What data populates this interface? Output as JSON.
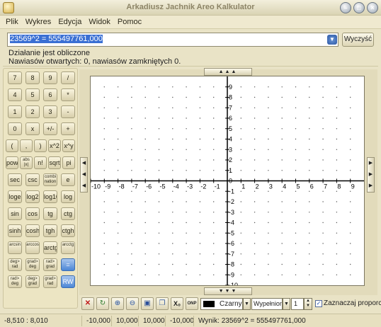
{
  "window": {
    "title": "Arkadiusz Jachnik Areo Kalkulator"
  },
  "menu": [
    "Plik",
    "Wykres",
    "Edycja",
    "Widok",
    "Pomoc"
  ],
  "expression": {
    "value": "23569^2 = 555497761,000",
    "clear_label": "Wyczyść"
  },
  "status": {
    "line1": "Działanie jest obliczone",
    "line2": "Nawiasów otwartych: 0, nawiasów zamkniętych 0."
  },
  "keypad": [
    [
      "7",
      "8",
      "9",
      "/"
    ],
    [
      "4",
      "5",
      "6",
      "*"
    ],
    [
      "1",
      "2",
      "3",
      "-"
    ],
    [
      "0",
      "x",
      "+/-",
      "+"
    ],
    [
      "(",
      ",",
      ")",
      "x^2",
      "x^y"
    ],
    [
      "pow",
      "abs |x|",
      "n!",
      "sqrt",
      "pi"
    ],
    [
      "sec",
      "csc",
      "combi nation",
      "e"
    ],
    [
      "loge",
      "log2",
      "log10",
      "log"
    ],
    [
      "sin",
      "cos",
      "tg",
      "ctg"
    ],
    [
      "sinh",
      "cosh",
      "tgh",
      "ctgh"
    ],
    [
      "arcsin",
      "arccos",
      "arctg",
      "arcctg"
    ],
    [
      "deg> rad",
      "grad> deg",
      "rad> grad",
      "="
    ],
    [
      "rad> deg",
      "deg> grad",
      "grad> rad",
      "RW"
    ]
  ],
  "graph": {
    "x_range": [
      -10,
      10
    ],
    "y_range": [
      -10,
      10
    ],
    "x_ticks": [
      "-10",
      "-9",
      "-8",
      "-7",
      "-6",
      "-5",
      "-4",
      "-3",
      "-2",
      "-1",
      "0",
      "1",
      "2",
      "3",
      "4",
      "5",
      "6",
      "7",
      "8",
      "9"
    ],
    "y_ticks": [
      "9",
      "8",
      "7",
      "6",
      "5",
      "4",
      "3",
      "2",
      "1",
      "0",
      "-1",
      "-2",
      "-3",
      "-4",
      "-5",
      "-6",
      "-7",
      "-8",
      "-9",
      "-10"
    ],
    "grid": "dots"
  },
  "toolbar": {
    "color_label": "Czarny",
    "fill_label": "Wypełniony",
    "line_width": "1",
    "proportions_label": "Zaznaczaj proporcje",
    "onp_label": "ONP",
    "color_swatch": "#000000"
  },
  "statusbar": {
    "coords": "-8,510 : 8,010",
    "xmin": "-10,000",
    "xmax": "10,000",
    "ymax": "10,000",
    "ymin": "-10,000",
    "result": "Wynik: 23569^2 = 555497761,000"
  }
}
